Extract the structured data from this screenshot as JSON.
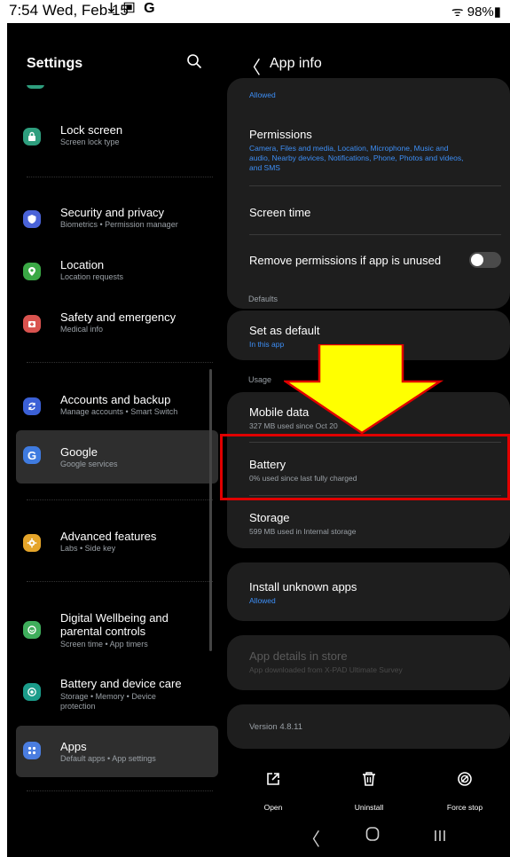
{
  "status_bar": {
    "time": "7:54",
    "date": "Wed, Feb 15",
    "icons": "⤓ ▣ G",
    "right": "ᯤ 98%▮"
  },
  "settings": {
    "title": "Settings",
    "items": [
      {
        "label": "Lock screen",
        "sub": "Screen lock type",
        "color": "#2e9e7e",
        "glyph": "🔒"
      },
      {
        "label": "Security and privacy",
        "sub": "Biometrics  •  Permission manager",
        "color": "#4a63d8",
        "glyph": "⛉"
      },
      {
        "label": "Location",
        "sub": "Location requests",
        "color": "#3aa845",
        "glyph": "●"
      },
      {
        "label": "Safety and emergency",
        "sub": "Medical info",
        "color": "#d9534f",
        "glyph": "▮"
      },
      {
        "label": "Accounts and backup",
        "sub": "Manage accounts  •  Smart Switch",
        "color": "#3b60d6",
        "glyph": "↻"
      },
      {
        "label": "Google",
        "sub": "Google services",
        "color": "#3f7be0",
        "glyph": "G"
      },
      {
        "label": "Advanced features",
        "sub": "Labs  •  Side key",
        "color": "#e5a52a",
        "glyph": "✱"
      },
      {
        "label": "Digital Wellbeing and",
        "label2": "parental controls",
        "sub": "Screen time  •  App timers",
        "color": "#3fae5c",
        "glyph": "◎"
      },
      {
        "label": "Battery and device care",
        "sub": "Storage  •  Memory  •  Device",
        "sub2": "protection",
        "color": "#1b9c8a",
        "glyph": "◉"
      },
      {
        "label": "Apps",
        "sub": "Default apps  •  App settings",
        "color": "#4a7de0",
        "glyph": "⠿"
      }
    ]
  },
  "app_info": {
    "title": "App info",
    "allowed_top": "Allowed",
    "permissions": {
      "label": "Permissions",
      "sub1": "Camera, Files and media, Location, Microphone, Music and",
      "sub2": "audio, Nearby devices, Notifications, Phone, Photos and videos,",
      "sub3": "and SMS"
    },
    "screen_time": "Screen time",
    "remove_permissions": "Remove permissions if app is unused",
    "defaults_header": "Defaults",
    "set_default": {
      "label": "Set as default",
      "sub": "In this app"
    },
    "usage_header": "Usage",
    "mobile_data": {
      "label": "Mobile data",
      "sub": "327 MB used since Oct 20"
    },
    "battery": {
      "label": "Battery",
      "sub": "0% used since last fully charged"
    },
    "storage": {
      "label": "Storage",
      "sub": "599 MB used in Internal storage"
    },
    "install_unknown": {
      "label": "Install unknown apps",
      "sub": "Allowed"
    },
    "app_details": {
      "label": "App details in store",
      "sub": "App downloaded from X-PAD Ultimate Survey"
    },
    "version": "Version 4.8.11",
    "actions": {
      "open": "Open",
      "uninstall": "Uninstall",
      "force_stop": "Force stop"
    }
  },
  "colors": {
    "accent_blue": "#3d8ef5",
    "highlight_red": "#e00000",
    "arrow_yellow": "#ffff00"
  }
}
